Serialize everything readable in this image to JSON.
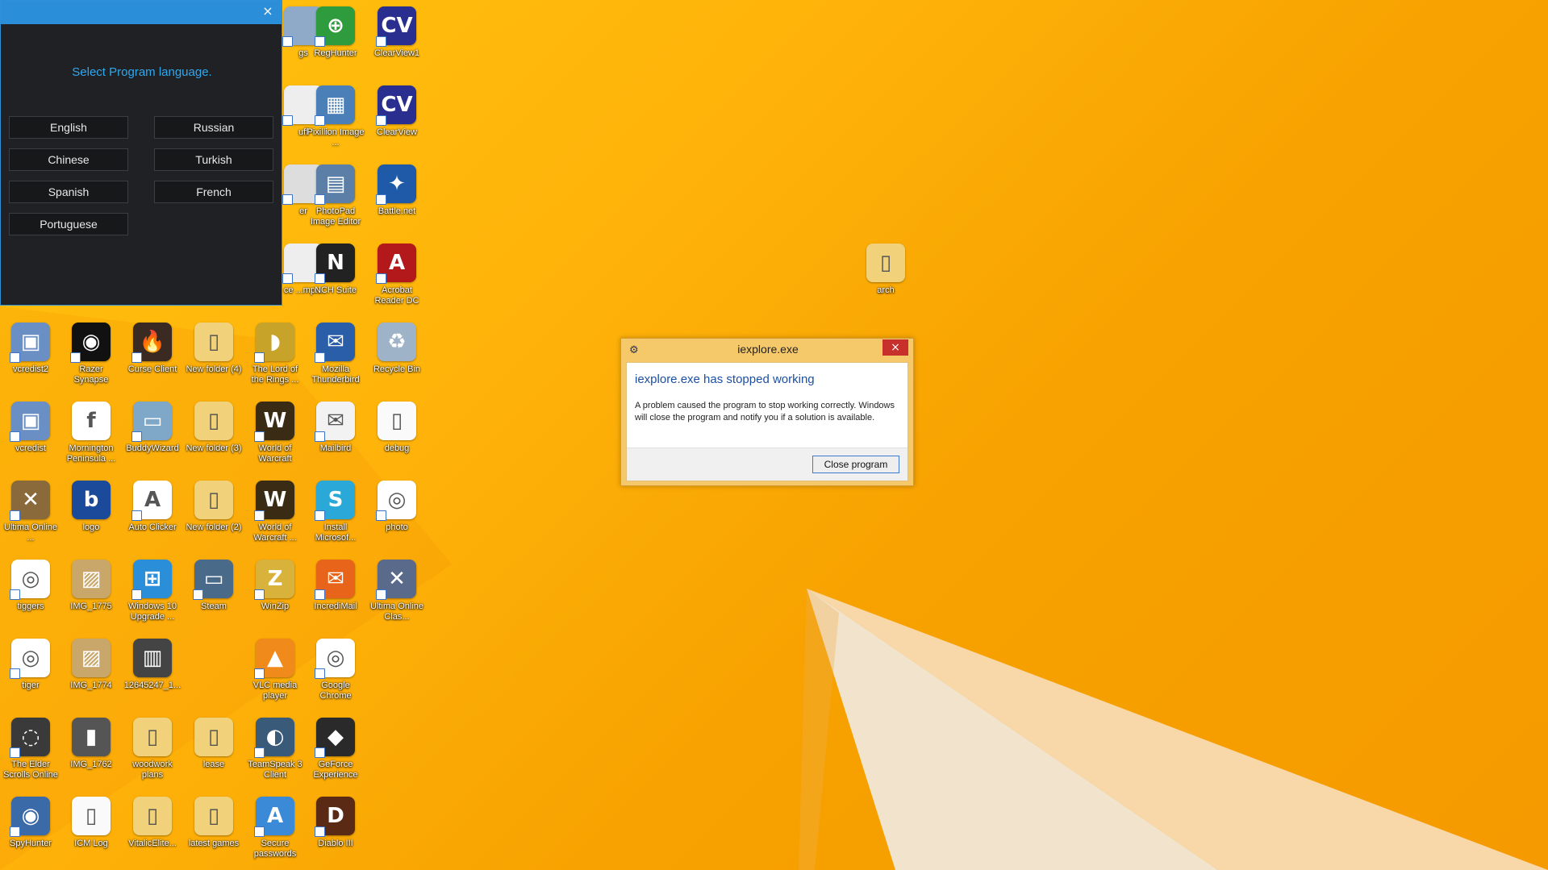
{
  "language_window": {
    "close_glyph": "×",
    "prompt": "Select Program language.",
    "buttons": [
      "English",
      "Russian",
      "Chinese",
      "Turkish",
      "Spanish",
      "French",
      "Portuguese"
    ]
  },
  "error_dialog": {
    "title": "iexplore.exe",
    "close_glyph": "×",
    "heading": "iexplore.exe has stopped working",
    "message": "A problem caused the program to stop working correctly. Windows will close the program and notify you if a solution is available.",
    "button": "Close program"
  },
  "desktop_icons": [
    {
      "label": "gs",
      "color": "#8fa9c9",
      "glyph": "",
      "icon": "partial-icon"
    },
    {
      "label": "RegHunter",
      "color": "#2e9b3d",
      "glyph": "⊕",
      "icon": "reghunter-icon"
    },
    {
      "label": "ClearView1",
      "color": "#2a2f8f",
      "glyph": "CV",
      "icon": "clearview-icon"
    },
    {
      "label": "uff",
      "color": "#eeeeee",
      "glyph": "",
      "icon": "partial-icon"
    },
    {
      "label": "Pixillion Image ...",
      "color": "#4a7fb8",
      "glyph": "▦",
      "icon": "pixillion-icon"
    },
    {
      "label": "ClearView",
      "color": "#2a2f8f",
      "glyph": "CV",
      "icon": "clearview-icon"
    },
    {
      "label": "er",
      "color": "#dddddd",
      "glyph": "",
      "icon": "partial-icon"
    },
    {
      "label": "PhotoPad Image Editor",
      "color": "#5b7fa6",
      "glyph": "▤",
      "icon": "photopad-icon"
    },
    {
      "label": "Battle.net",
      "color": "#1e5aa8",
      "glyph": "✦",
      "icon": "battlenet-icon"
    },
    {
      "label": "ce ...mp...",
      "color": "#eeeeee",
      "glyph": "",
      "icon": "partial-icon"
    },
    {
      "label": "NCH Suite",
      "color": "#222222",
      "glyph": "N",
      "icon": "nch-suite-icon"
    },
    {
      "label": "Acrobat Reader DC",
      "color": "#b3181b",
      "glyph": "A",
      "icon": "acrobat-icon"
    },
    {
      "label": "arch",
      "color": "#f1d27a",
      "glyph": "▯",
      "icon": "folder-icon"
    },
    {
      "label": "vcredist2",
      "color": "#6a8fc4",
      "glyph": "▣",
      "icon": "installer-icon"
    },
    {
      "label": "Razer Synapse",
      "color": "#111111",
      "glyph": "◉",
      "icon": "razer-icon"
    },
    {
      "label": "Curse Client",
      "color": "#3a2a22",
      "glyph": "🔥",
      "icon": "curse-icon"
    },
    {
      "label": "New folder (4)",
      "color": "#f1d27a",
      "glyph": "▯",
      "icon": "folder-icon"
    },
    {
      "label": "The Lord of the Rings ...",
      "color": "#c8a32a",
      "glyph": "◗",
      "icon": "lotro-icon"
    },
    {
      "label": "Mozilla Thunderbird",
      "color": "#2a5ea8",
      "glyph": "✉",
      "icon": "thunderbird-icon"
    },
    {
      "label": "Recycle Bin",
      "color": "#9fb3c8",
      "glyph": "♻",
      "icon": "recycle-bin-icon"
    },
    {
      "label": "vcredist",
      "color": "#6a8fc4",
      "glyph": "▣",
      "icon": "installer-icon"
    },
    {
      "label": "Mornington Peninsula ...",
      "color": "#ffffff",
      "glyph": "f",
      "icon": "document-icon"
    },
    {
      "label": "BuddyWizard",
      "color": "#7fa7c8",
      "glyph": "▭",
      "icon": "buddywizard-icon"
    },
    {
      "label": "New folder (3)",
      "color": "#f1d27a",
      "glyph": "▯",
      "icon": "folder-icon"
    },
    {
      "label": "World of Warcraft",
      "color": "#3a2c14",
      "glyph": "W",
      "icon": "wow-icon"
    },
    {
      "label": "Mailbird",
      "color": "#f2f2f2",
      "glyph": "✉",
      "icon": "mailbird-icon"
    },
    {
      "label": "debug",
      "color": "#fafafa",
      "glyph": "▯",
      "icon": "text-file-icon"
    },
    {
      "label": "Ultima Online ...",
      "color": "#8a6a3a",
      "glyph": "✕",
      "icon": "ultima-icon"
    },
    {
      "label": "logo",
      "color": "#1b4a9a",
      "glyph": "b",
      "icon": "image-file-icon"
    },
    {
      "label": "Auto Clicker",
      "color": "#ffffff",
      "glyph": "A",
      "icon": "auto-clicker-icon"
    },
    {
      "label": "New folder (2)",
      "color": "#f1d27a",
      "glyph": "▯",
      "icon": "folder-icon"
    },
    {
      "label": "World of Warcraft ...",
      "color": "#3a2c14",
      "glyph": "W",
      "icon": "wow-icon"
    },
    {
      "label": "Install Microsof...",
      "color": "#2aa8d8",
      "glyph": "S",
      "icon": "skype-installer-icon"
    },
    {
      "label": "photo",
      "color": "#ffffff",
      "glyph": "◎",
      "icon": "chrome-icon"
    },
    {
      "label": "tiggers",
      "color": "#ffffff",
      "glyph": "◎",
      "icon": "chrome-icon"
    },
    {
      "label": "IMG_1775",
      "color": "#c9a76a",
      "glyph": "▨",
      "icon": "image-file-icon"
    },
    {
      "label": "Windows 10 Upgrade ...",
      "color": "#2a8fd8",
      "glyph": "⊞",
      "icon": "windows-icon"
    },
    {
      "label": "Steam",
      "color": "#4a6a8a",
      "glyph": "▭",
      "icon": "steam-icon"
    },
    {
      "label": "WinZip",
      "color": "#d8b23a",
      "glyph": "Z",
      "icon": "winzip-icon"
    },
    {
      "label": "IncrediMail",
      "color": "#e8641a",
      "glyph": "✉",
      "icon": "incredimail-icon"
    },
    {
      "label": "Ultima Online Clas...",
      "color": "#5a6a8a",
      "glyph": "✕",
      "icon": "ultima-icon"
    },
    {
      "label": "tiger",
      "color": "#ffffff",
      "glyph": "◎",
      "icon": "chrome-icon"
    },
    {
      "label": "IMG_1774",
      "color": "#c9a76a",
      "glyph": "▨",
      "icon": "image-file-icon"
    },
    {
      "label": "12645247_1...",
      "color": "#444444",
      "glyph": "▥",
      "icon": "image-file-icon"
    },
    {
      "label": "VLC media player",
      "color": "#f08a1a",
      "glyph": "▲",
      "icon": "vlc-icon"
    },
    {
      "label": "Google Chrome",
      "color": "#ffffff",
      "glyph": "◎",
      "icon": "chrome-icon"
    },
    {
      "label": "The Elder Scrolls Online",
      "color": "#3a3a3a",
      "glyph": "◌",
      "icon": "eso-icon"
    },
    {
      "label": "IMG_1762",
      "color": "#555555",
      "glyph": "▮",
      "icon": "image-file-icon"
    },
    {
      "label": "woodwork plans",
      "color": "#f1d27a",
      "glyph": "▯",
      "icon": "folder-icon"
    },
    {
      "label": "lease",
      "color": "#f1d27a",
      "glyph": "▯",
      "icon": "folder-icon"
    },
    {
      "label": "TeamSpeak 3 Client",
      "color": "#3a5a7a",
      "glyph": "◐",
      "icon": "teamspeak-icon"
    },
    {
      "label": "GeForce Experience",
      "color": "#2a2a2a",
      "glyph": "◆",
      "icon": "geforce-icon"
    },
    {
      "label": "SpyHunter",
      "color": "#3a6aa8",
      "glyph": "◉",
      "icon": "spyhunter-icon"
    },
    {
      "label": "ICM Log",
      "color": "#fafafa",
      "glyph": "▯",
      "icon": "text-file-icon"
    },
    {
      "label": "VitalicElite...",
      "color": "#f1d27a",
      "glyph": "▯",
      "icon": "folder-icon"
    },
    {
      "label": "latest games",
      "color": "#f1d27a",
      "glyph": "▯",
      "icon": "folder-icon"
    },
    {
      "label": "Secure passwords",
      "color": "#3a8ad8",
      "glyph": "A",
      "icon": "secure-passwords-icon"
    },
    {
      "label": "Diablo III",
      "color": "#5a2a14",
      "glyph": "D",
      "icon": "diablo-icon"
    }
  ]
}
